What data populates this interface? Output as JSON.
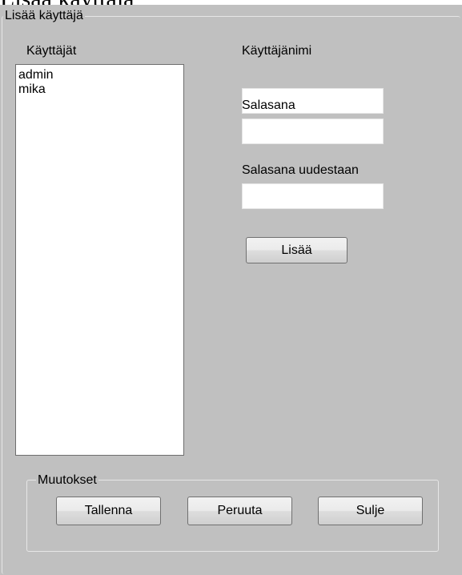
{
  "form": {
    "groupbox_title": "Lisää käyttäjä",
    "users_label": "Käyttäjät",
    "users": [
      "admin",
      "mika"
    ],
    "username_label": "Käyttäjänimi",
    "username_value": "",
    "password_label": "Salasana",
    "password_value": "",
    "password_again_label": "Salasana uudestaan",
    "password_again_value": "",
    "add_button": "Lisää"
  },
  "changes": {
    "groupbox_title": "Muutokset",
    "save_button": "Tallenna",
    "cancel_button": "Peruuta",
    "close_button": "Sulje"
  }
}
